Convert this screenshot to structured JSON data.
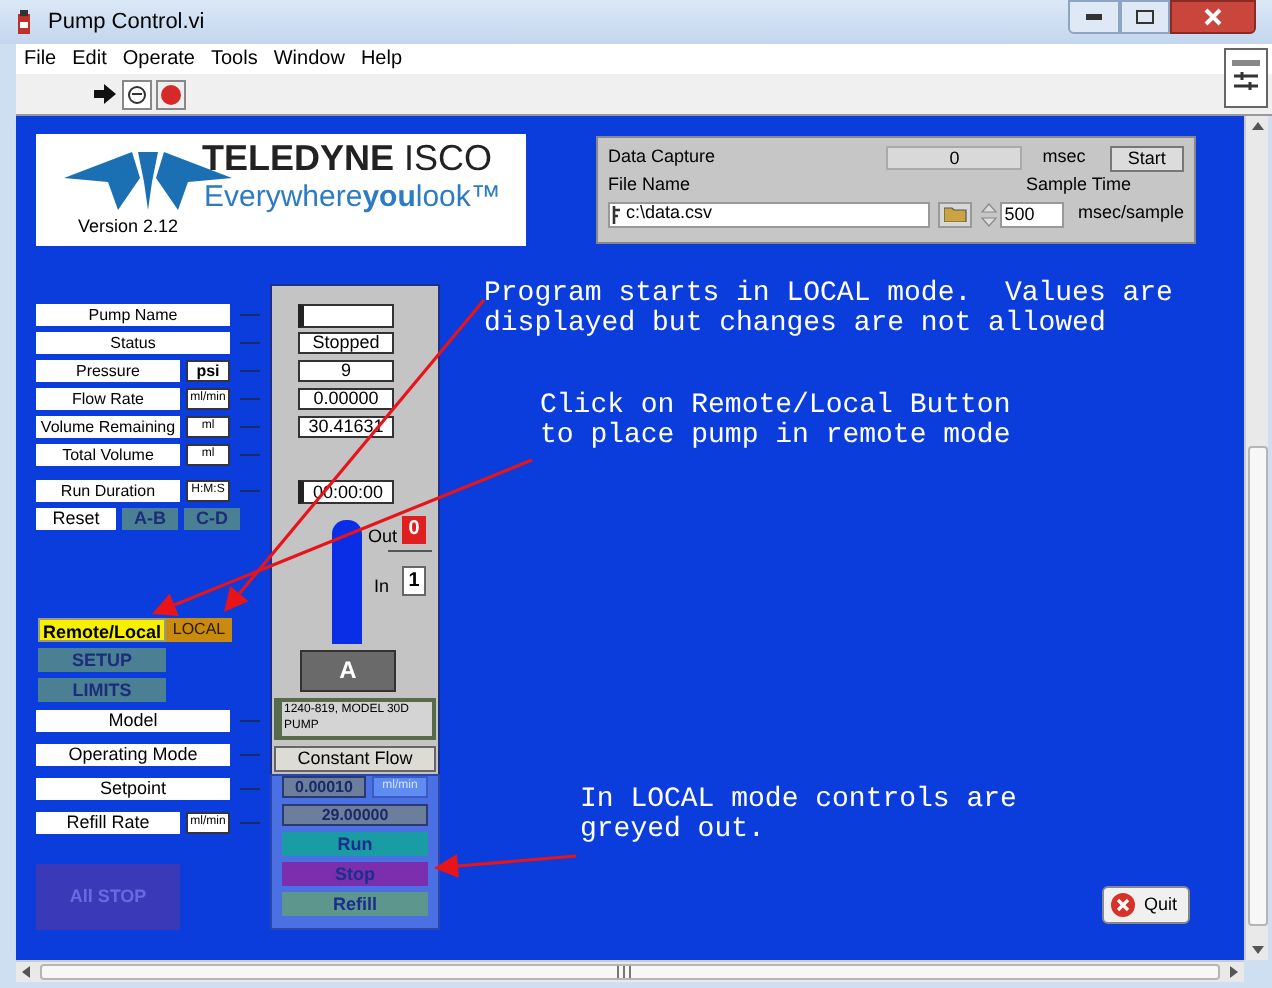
{
  "window": {
    "title": "Pump Control.vi"
  },
  "menu": [
    "File",
    "Edit",
    "Operate",
    "Tools",
    "Window",
    "Help"
  ],
  "logo": {
    "brand": "**TELEDYNE** ISCO",
    "tagline": "Everywhere**you**look™",
    "version": "Version 2.12"
  },
  "data_capture": {
    "title": "Data Capture",
    "value": "0",
    "unit": "msec",
    "start_button": "Start",
    "file_label": "File Name",
    "file_path": "c:\\data.csv",
    "sample_label": "Sample Time",
    "sample_time": "500",
    "sample_unit": "msec/sample"
  },
  "pump_fields": [
    {
      "label": "Pump Name",
      "kind": "control"
    },
    {
      "label": "Status",
      "kind": "indicator",
      "value": "Stopped"
    },
    {
      "label": "Pressure",
      "unit": "psi",
      "kind": "indicator",
      "value": "9"
    },
    {
      "label": "Flow Rate",
      "unit": "ml/min",
      "kind": "indicator",
      "value": "0.00000"
    },
    {
      "label": "Volume Remaining",
      "unit": "ml",
      "kind": "indicator",
      "value": "30.41631"
    },
    {
      "label": "Total Volume",
      "unit": "ml",
      "kind": "hidden"
    },
    {
      "label": "Run Duration",
      "unit": "H:M:S",
      "kind": "control",
      "value": "00:00:00"
    }
  ],
  "reset": {
    "label": "Reset",
    "buttons": [
      {
        "label": "A-B",
        "disabled": true
      },
      {
        "label": "C-D",
        "disabled": true
      }
    ]
  },
  "tank": {
    "out_label": "Out",
    "out_value": "0",
    "in_label": "In",
    "in_value": "1",
    "pump": "A"
  },
  "remote_local": {
    "label": "Remote/Local",
    "value": "LOCAL"
  },
  "mode_buttons": [
    {
      "label": "SETUP",
      "disabled": true
    },
    {
      "label": "LIMITS",
      "disabled": true
    }
  ],
  "settings": [
    {
      "label": "Model",
      "value": "1240-819, MODEL 30D PUMP"
    },
    {
      "label": "Operating Mode",
      "value": "Constant Flow"
    },
    {
      "label": "Setpoint",
      "value": "0.00010",
      "value_unit": "ml/min",
      "disabled": true
    },
    {
      "label": "Refill Rate",
      "unit": "ml/min",
      "value": "29.00000",
      "disabled": true
    }
  ],
  "pump_buttons": [
    {
      "label": "Run",
      "color": "#1a9ca4",
      "disabled": true
    },
    {
      "label": "Stop",
      "color": "#7b2fae",
      "disabled": true
    },
    {
      "label": "Refill",
      "color": "#5d968c",
      "disabled": true
    }
  ],
  "all_stop": {
    "label": "All STOP",
    "disabled": true
  },
  "quit": {
    "label": "Quit"
  },
  "annotations": [
    {
      "text": "Program starts in LOCAL mode.  Values are\ndisplayed but changes are not allowed"
    },
    {
      "text": "Click on Remote/Local Button\nto place pump in remote mode"
    },
    {
      "text": "In LOCAL mode controls are\ngreyed out."
    }
  ]
}
